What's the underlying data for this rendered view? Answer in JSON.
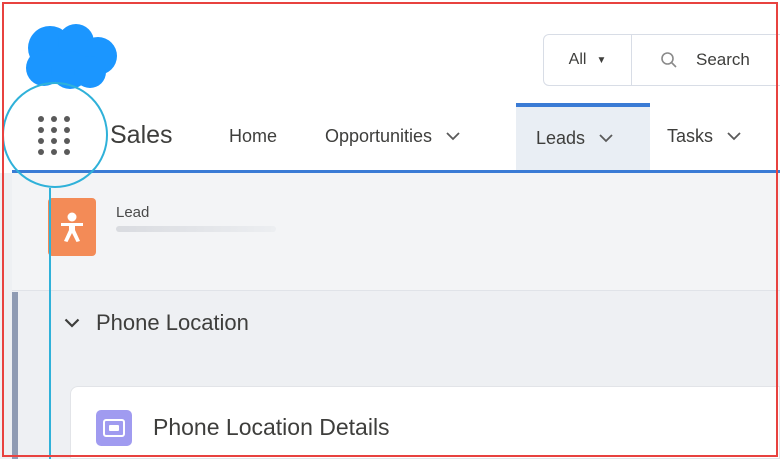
{
  "header": {
    "search_scope": "All",
    "search_placeholder": "Search"
  },
  "nav": {
    "app_name": "Sales",
    "tabs": [
      {
        "label": "Home",
        "has_menu": false,
        "active": false
      },
      {
        "label": "Opportunities",
        "has_menu": true,
        "active": false
      },
      {
        "label": "Leads",
        "has_menu": true,
        "active": true
      },
      {
        "label": "Tasks",
        "has_menu": true,
        "active": false
      }
    ]
  },
  "record": {
    "object_label": "Lead"
  },
  "section": {
    "title": "Phone Location",
    "expanded": true
  },
  "card": {
    "title": "Phone Location Details"
  },
  "colors": {
    "brand_blue": "#1b96ff",
    "active_tab_accent": "#3a7bd5",
    "lead_icon": "#f38b57",
    "details_icon": "#a09bf0",
    "annotation_frame": "#e8423f",
    "annotation_callout": "#2fb1d9"
  },
  "icons": {
    "logo": "cloud-logo",
    "launcher": "app-launcher-icon",
    "search": "search-icon",
    "lead": "lead-icon",
    "details": "card-icon"
  }
}
